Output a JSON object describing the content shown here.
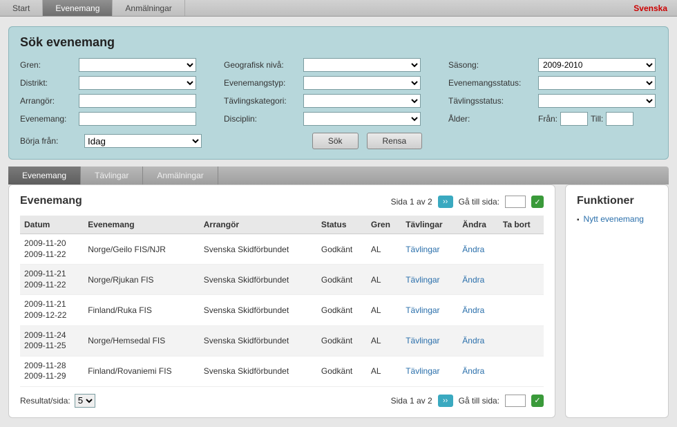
{
  "topnav": {
    "tabs": [
      {
        "label": "Start"
      },
      {
        "label": "Evenemang"
      },
      {
        "label": "Anmälningar"
      }
    ],
    "active_index": 1,
    "language": "Svenska"
  },
  "search": {
    "title": "Sök evenemang",
    "labels": {
      "gren": "Gren:",
      "distrikt": "Distrikt:",
      "arrangor": "Arrangör:",
      "evenemang": "Evenemang:",
      "geo": "Geografisk nivå:",
      "typ": "Evenemangstyp:",
      "kategori": "Tävlingskategori:",
      "disciplin": "Disciplin:",
      "sasong": "Säsong:",
      "evstatus": "Evenemangsstatus:",
      "tavstatus": "Tävlingsstatus:",
      "alder": "Ålder:",
      "fran": "Från:",
      "till": "Till:",
      "borja": "Börja från:"
    },
    "values": {
      "sasong": "2009-2010",
      "borja": "Idag"
    },
    "buttons": {
      "sok": "Sök",
      "rensa": "Rensa"
    }
  },
  "subtabs": {
    "items": [
      {
        "label": "Evenemang"
      },
      {
        "label": "Tävlingar"
      },
      {
        "label": "Anmälningar"
      }
    ],
    "active_index": 0
  },
  "events": {
    "title": "Evenemang",
    "pager": {
      "text": "Sida 1 av 2",
      "goto_label": "Gå till sida:"
    },
    "columns": [
      "Datum",
      "Evenemang",
      "Arrangör",
      "Status",
      "Gren",
      "Tävlingar",
      "Ändra",
      "Ta bort"
    ],
    "rows": [
      {
        "date1": "2009-11-20",
        "date2": "2009-11-22",
        "name": "Norge/Geilo FIS/NJR",
        "arr": "Svenska Skidförbundet",
        "status": "Godkänt",
        "gren": "AL",
        "tavlingar": "Tävlingar",
        "andra": "Ändra"
      },
      {
        "date1": "2009-11-21",
        "date2": "2009-11-22",
        "name": "Norge/Rjukan FIS",
        "arr": "Svenska Skidförbundet",
        "status": "Godkänt",
        "gren": "AL",
        "tavlingar": "Tävlingar",
        "andra": "Ändra"
      },
      {
        "date1": "2009-11-21",
        "date2": "2009-12-22",
        "name": "Finland/Ruka FIS",
        "arr": "Svenska Skidförbundet",
        "status": "Godkänt",
        "gren": "AL",
        "tavlingar": "Tävlingar",
        "andra": "Ändra"
      },
      {
        "date1": "2009-11-24",
        "date2": "2009-11-25",
        "name": "Norge/Hemsedal FIS",
        "arr": "Svenska Skidförbundet",
        "status": "Godkänt",
        "gren": "AL",
        "tavlingar": "Tävlingar",
        "andra": "Ändra"
      },
      {
        "date1": "2009-11-28",
        "date2": "2009-11-29",
        "name": "Finland/Rovaniemi FIS",
        "arr": "Svenska Skidförbundet",
        "status": "Godkänt",
        "gren": "AL",
        "tavlingar": "Tävlingar",
        "andra": "Ändra"
      }
    ],
    "results": {
      "label": "Resultat/sida:",
      "value": "5"
    }
  },
  "functions": {
    "title": "Funktioner",
    "items": [
      {
        "label": "Nytt evenemang"
      }
    ]
  }
}
